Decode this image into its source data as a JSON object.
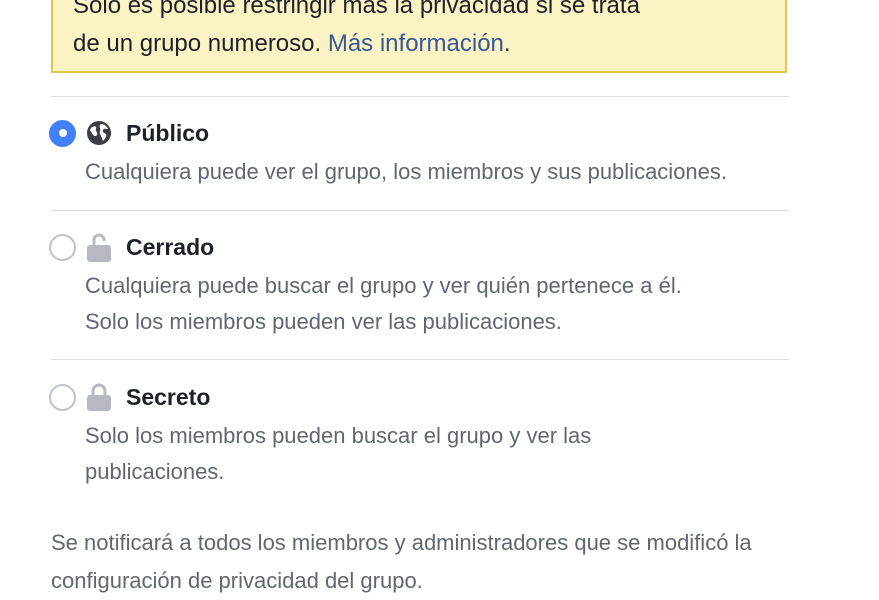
{
  "notice": {
    "line1": "Solo es posible restringir más la privacidad si se trata",
    "line2_text": "de un grupo numeroso. ",
    "link": "Más información",
    "line2_end": "."
  },
  "options": [
    {
      "title": "Público",
      "icon": "globe-icon",
      "selected": true,
      "desc": [
        "Cualquiera puede ver el grupo, los miembros y sus publicaciones."
      ]
    },
    {
      "title": "Cerrado",
      "icon": "unlocked-padlock-icon",
      "selected": false,
      "desc": [
        "Cualquiera puede buscar el grupo y ver quién pertenece a él.",
        "Solo los miembros pueden ver las publicaciones."
      ]
    },
    {
      "title": "Secreto",
      "icon": "padlock-icon",
      "selected": false,
      "desc": [
        "Solo los miembros pueden buscar el grupo y ver las",
        "publicaciones."
      ]
    }
  ],
  "footer": {
    "line1": "Se notificará a todos los miembros y administradores que se modificó la",
    "line2": "configuración de privacidad del grupo."
  },
  "colors": {
    "radio_selected": "#4080ff",
    "link": "#365899",
    "notice_bg": "#fcf3c5",
    "notice_border": "#e0c64f"
  }
}
